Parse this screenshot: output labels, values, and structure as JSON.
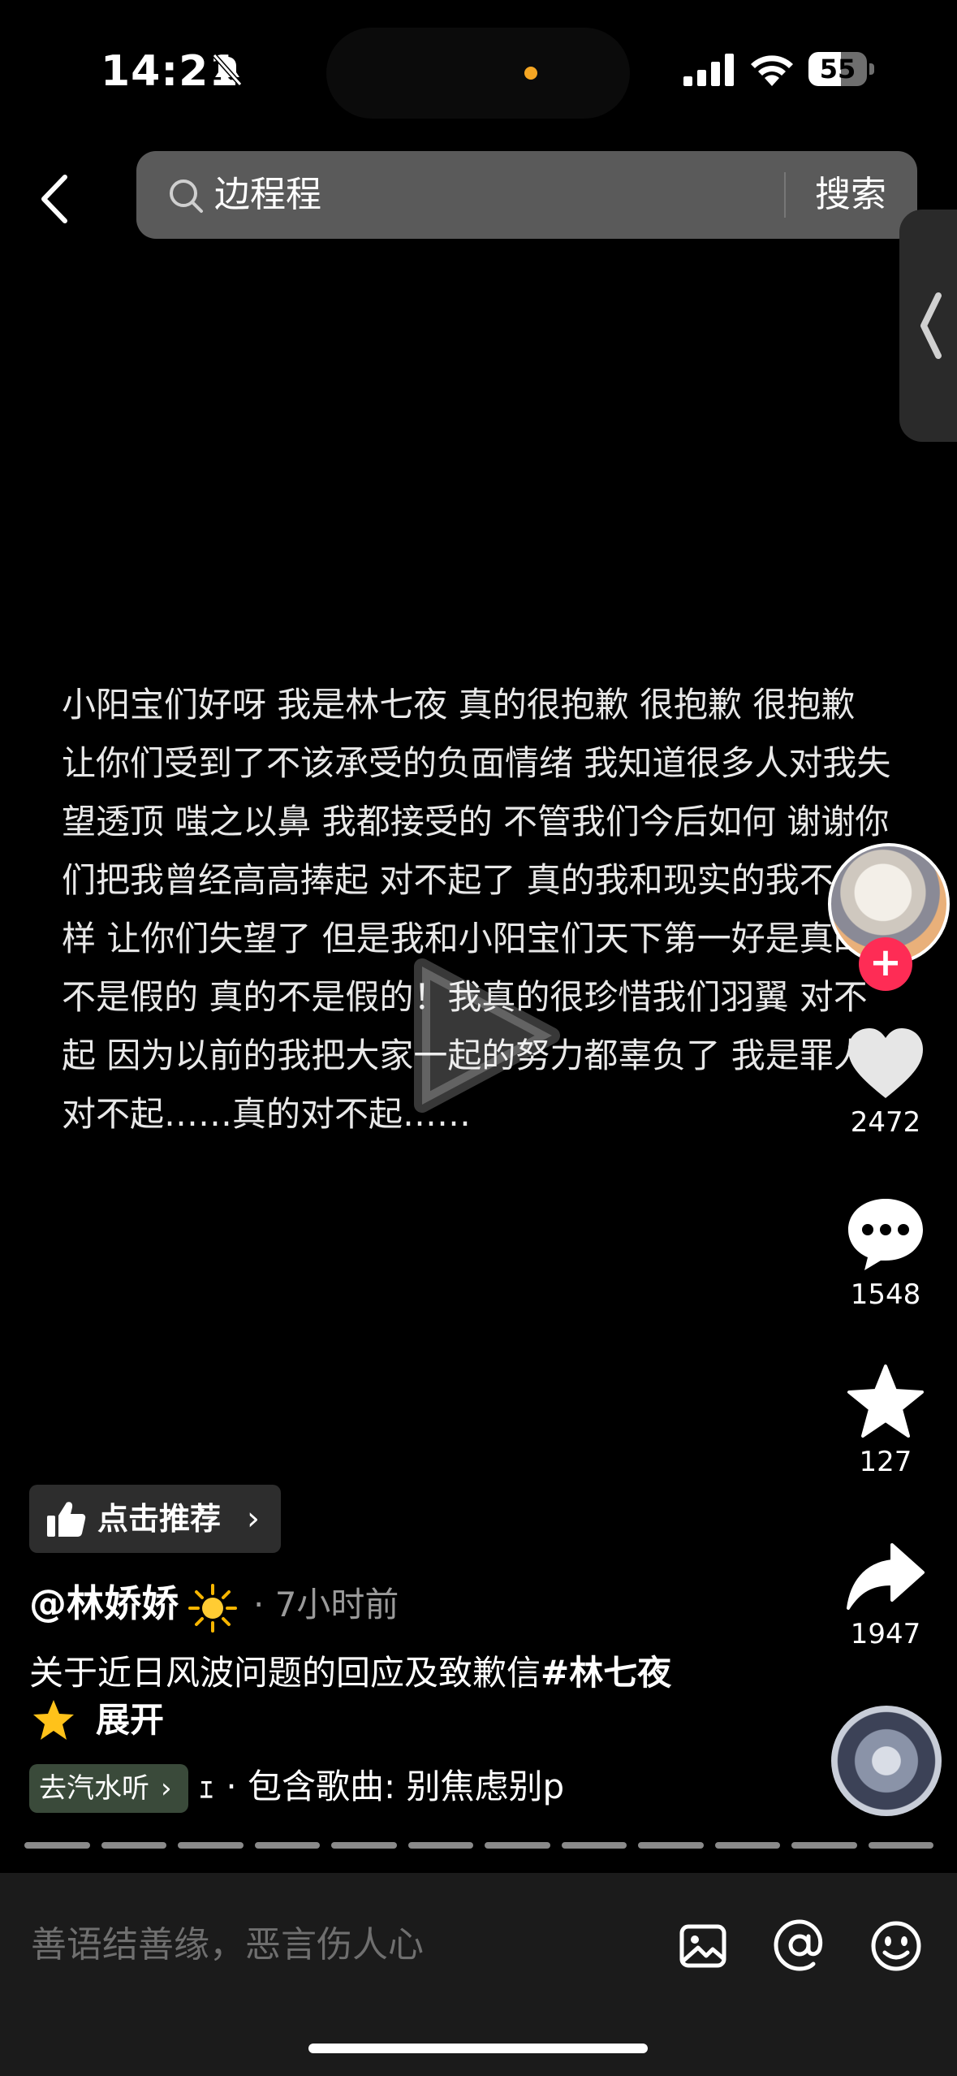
{
  "status_bar": {
    "time": "14:21",
    "battery": "55",
    "battery_level": 0.55
  },
  "search": {
    "query": "边程程",
    "button": "搜索"
  },
  "content": {
    "text": "小阳宝们好呀 我是林七夜 真的很抱歉 很抱歉 很抱歉 让你们受到了不该承受的负面情绪 我知道很多人对我失望透顶 嗤之以鼻 我都接受的 不管我们今后如何 谢谢你们把我曾经高高捧起 对不起了 真的我和现实的我不一样 让你们失望了 但是我和小阳宝们天下第一好是真的 不是假的 真的不是假的！我真的很珍惜我们羽翼 对不起 因为以前的我把大家一起的努力都辜负了 我是罪人 对不起……真的对不起……"
  },
  "actions": {
    "likes": "2472",
    "comments": "1548",
    "favorites": "127",
    "shares": "1947",
    "follow": "+"
  },
  "post": {
    "recommend_label": "点击推荐",
    "author": "@林娇娇",
    "time_ago": "· 7小时前",
    "caption": "关于近日风波问题的回应及致歉信",
    "hashtag": "#林七夜",
    "expand": "展开",
    "music_chip": "去汽水听",
    "music_info": "ｪ · 包含歌曲: 别焦虑别p"
  },
  "comment_bar": {
    "placeholder": "善语结善缘，恶言伤人心"
  },
  "icons": [
    "bell-slash-icon",
    "signal-icon",
    "wifi-icon",
    "battery-icon",
    "back-icon",
    "search-icon",
    "side-panel-chevron-icon",
    "play-icon",
    "heart-icon",
    "comment-icon",
    "star-icon",
    "share-icon",
    "thumbs-up-icon",
    "sun-emoji-icon",
    "star-emoji-icon",
    "image-icon",
    "at-icon",
    "emoji-icon"
  ],
  "colors": {
    "accent_red": "#fe2c55",
    "background": "#000000"
  }
}
